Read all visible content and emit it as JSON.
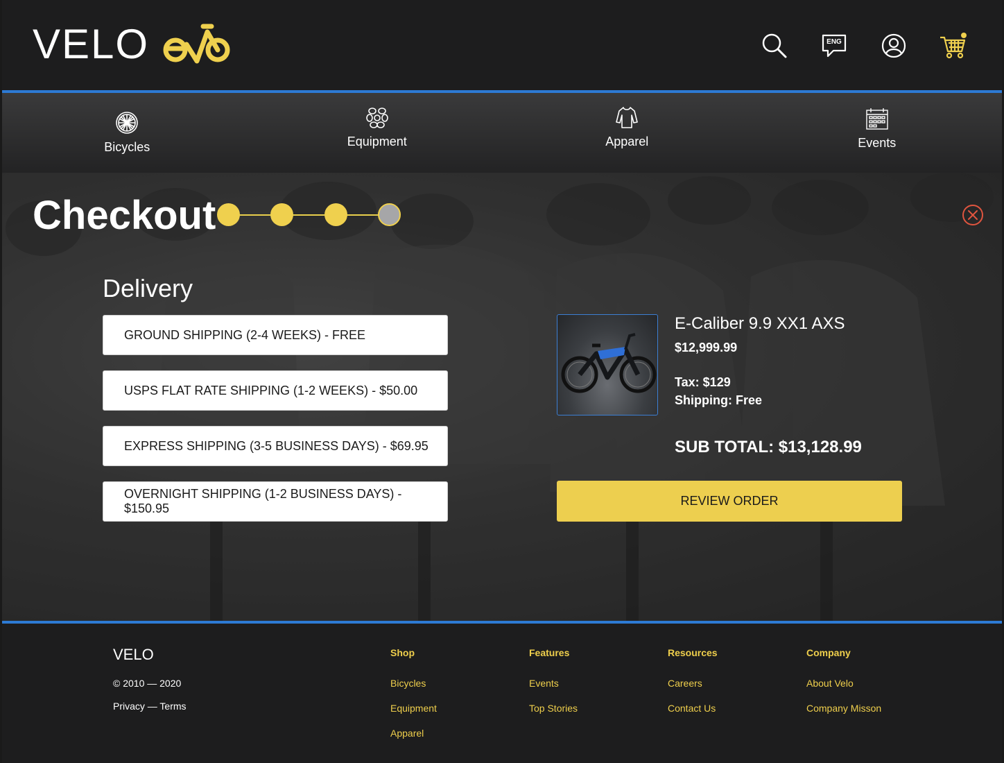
{
  "header": {
    "brand": "VELO",
    "lang_badge": "ENG"
  },
  "nav": [
    {
      "label": "Bicycles"
    },
    {
      "label": "Equipment"
    },
    {
      "label": "Apparel"
    },
    {
      "label": "Events"
    }
  ],
  "checkout": {
    "title": "Checkout",
    "steps_completed": 3,
    "steps_total": 4,
    "section_title": "Delivery",
    "shipping_options": [
      "GROUND SHIPPING (2-4 WEEKS) - FREE",
      "USPS FLAT RATE SHIPPING (1-2 WEEKS) - $50.00",
      "EXPRESS SHIPPING (3-5 BUSINESS DAYS) - $69.95",
      "OVERNIGHT SHIPPING (1-2 BUSINESS DAYS) - $150.95"
    ],
    "product": {
      "name": "E-Caliber 9.9 XX1 AXS",
      "price": "$12,999.99",
      "tax": "Tax: $129",
      "shipping": "Shipping: Free",
      "subtotal": "SUB TOTAL: $13,128.99"
    },
    "review_button": "REVIEW ORDER"
  },
  "footer": {
    "brand": "VELO",
    "copyright": "© 2010 — 2020",
    "legal": "Privacy — Terms",
    "columns": [
      {
        "heading": "Shop",
        "links": [
          "Bicycles",
          "Equipment",
          "Apparel"
        ]
      },
      {
        "heading": "Features",
        "links": [
          "Events",
          "Top Stories"
        ]
      },
      {
        "heading": "Resources",
        "links": [
          "Careers",
          "Contact Us"
        ]
      },
      {
        "heading": "Company",
        "links": [
          "About Velo",
          "Company Misson"
        ]
      }
    ]
  },
  "colors": {
    "accent": "#efd04e",
    "divider": "#2d7ad4",
    "dark": "#1d1d1e",
    "close": "#e0553f"
  }
}
